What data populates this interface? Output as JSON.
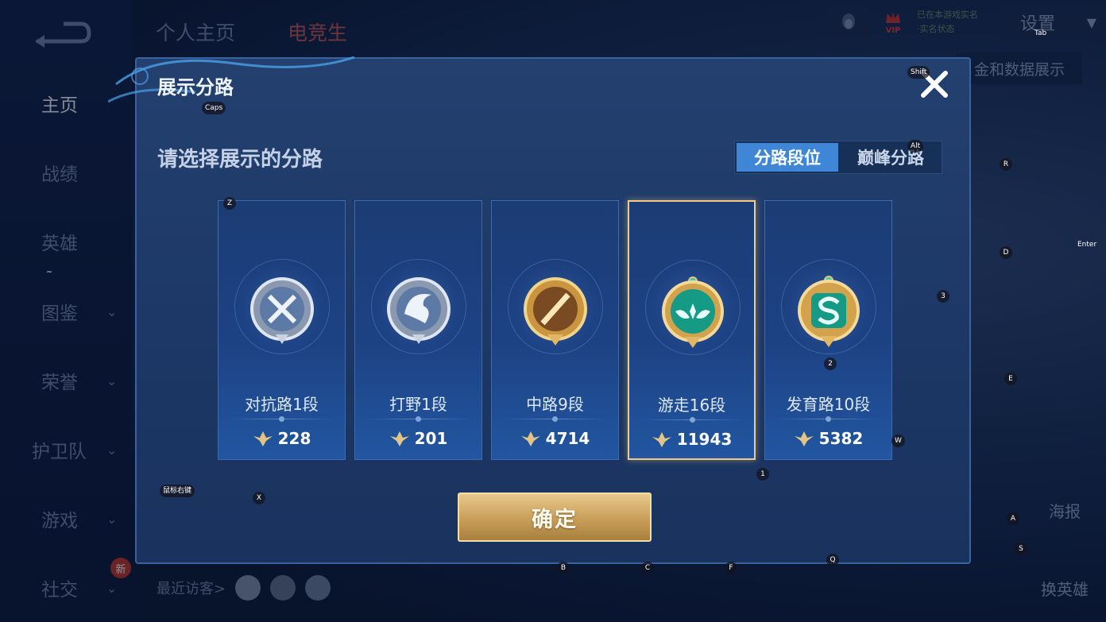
{
  "sidebar": {
    "items": [
      {
        "label": "主页",
        "active": true,
        "chevron": false
      },
      {
        "label": "战绩",
        "active": false,
        "chevron": false
      },
      {
        "label": "英雄",
        "active": false,
        "chevron": false
      },
      {
        "label": "图鉴",
        "active": false,
        "chevron": true
      },
      {
        "label": "荣誉",
        "active": false,
        "chevron": true
      },
      {
        "label": "护卫队",
        "active": false,
        "chevron": true
      },
      {
        "label": "游戏",
        "active": false,
        "chevron": true
      },
      {
        "label": "社交",
        "active": false,
        "chevron": true
      }
    ],
    "new_badge": "新"
  },
  "header": {
    "tabs": [
      "个人主页",
      "电竞生"
    ],
    "vip_label": "VIP",
    "vip_lines": [
      "已在本游戏实名",
      "·实名状态"
    ],
    "settings_label": "设置",
    "data_display": "金和数据展示"
  },
  "bottom": {
    "recent_visitors": "最近访客>",
    "poster": "海报",
    "change_hero": "换英雄"
  },
  "modal": {
    "title": "展示分路",
    "subtitle": "请选择展示的分路",
    "segments": [
      {
        "label": "分路段位",
        "selected": true
      },
      {
        "label": "巅峰分路",
        "selected": false
      }
    ],
    "cards": [
      {
        "name": "对抗路1段",
        "score": "228",
        "selected": false,
        "badge": "silver-sword",
        "color": "#b8c6d8"
      },
      {
        "name": "打野1段",
        "score": "201",
        "selected": false,
        "badge": "silver-dragon",
        "color": "#b8c6d8"
      },
      {
        "name": "中路9段",
        "score": "4714",
        "selected": false,
        "badge": "gold-staff",
        "color": "#d9a54a"
      },
      {
        "name": "游走16段",
        "score": "11943",
        "selected": true,
        "badge": "gold-wings",
        "color": "#2fbfa0"
      },
      {
        "name": "发育路10段",
        "score": "5382",
        "selected": false,
        "badge": "gold-s",
        "color": "#2fbfa0"
      }
    ],
    "confirm_label": "确定"
  },
  "key_hints": [
    {
      "label": "Caps"
    },
    {
      "label": "Shift"
    },
    {
      "label": "Tab"
    },
    {
      "label": "Alt"
    },
    {
      "label": "Z"
    },
    {
      "label": "R"
    },
    {
      "label": "Enter"
    },
    {
      "label": "D"
    },
    {
      "label": "3"
    },
    {
      "label": "~"
    },
    {
      "label": "2"
    },
    {
      "label": "E"
    },
    {
      "label": "W"
    },
    {
      "label": "1"
    },
    {
      "label": "鼠标右键"
    },
    {
      "label": "X"
    },
    {
      "label": "A"
    },
    {
      "label": "S"
    },
    {
      "label": "B"
    },
    {
      "label": "C"
    },
    {
      "label": "F"
    },
    {
      "label": "Q"
    }
  ],
  "colors": {
    "accent_blue": "#3f86d6",
    "gold": "#c89e58",
    "selected_border": "#f2c98a"
  }
}
